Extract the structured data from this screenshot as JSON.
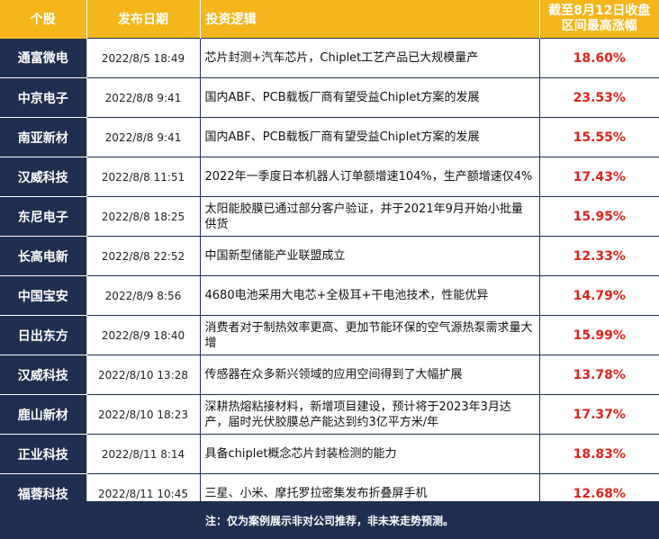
{
  "header": {
    "col_stock": "个股",
    "col_date": "发布日期",
    "col_logic": "投资逻辑",
    "col_gain_line1": "截至8月12日收盘",
    "col_gain_line2": "区间最高涨幅"
  },
  "rows": [
    {
      "name": "通富微电",
      "date": "2022/8/5 18:49",
      "logic": "芯片封测+汽车芯片，Chiplet工艺产品已大规模量产",
      "gain": "18.60%"
    },
    {
      "name": "中京电子",
      "date": "2022/8/8 9:41",
      "logic": "国内ABF、PCB载板厂商有望受益Chiplet方案的发展",
      "gain": "23.53%"
    },
    {
      "name": "南亚新材",
      "date": "2022/8/8 9:41",
      "logic": "国内ABF、PCB载板厂商有望受益Chiplet方案的发展",
      "gain": "15.55%"
    },
    {
      "name": "汉威科技",
      "date": "2022/8/8 11:51",
      "logic": "2022年一季度日本机器人订单额增速104%，生产额增速仅4%",
      "gain": "17.43%"
    },
    {
      "name": "东尼电子",
      "date": "2022/8/8 18:25",
      "logic": "太阳能胶膜已通过部分客户验证，并于2021年9月开始小批量供货",
      "gain": "15.95%"
    },
    {
      "name": "长高电新",
      "date": "2022/8/8 22:52",
      "logic": "中国新型储能产业联盟成立",
      "gain": "12.33%"
    },
    {
      "name": "中国宝安",
      "date": "2022/8/9 8:56",
      "logic": "4680电池采用大电芯+全极耳+干电池技术，性能优异",
      "gain": "14.79%"
    },
    {
      "name": "日出东方",
      "date": "2022/8/9 18:40",
      "logic": "消费者对于制热效率更高、更加节能环保的空气源热泵需求量大增",
      "gain": "15.99%"
    },
    {
      "name": "汉威科技",
      "date": "2022/8/10 13:28",
      "logic": "传感器在众多新兴领域的应用空间得到了大幅扩展",
      "gain": "13.78%"
    },
    {
      "name": "鹿山新材",
      "date": "2022/8/10 18:23",
      "logic": "深耕热熔粘接材料，新增项目建设，预计将于2023年3月达产，届时光伏胶膜总产能达到约3亿平方米/年",
      "gain": "17.37%"
    },
    {
      "name": "正业科技",
      "date": "2022/8/11 8:14",
      "logic": "具备chiplet概念芯片封装检测的能力",
      "gain": "18.83%"
    },
    {
      "name": "福蓉科技",
      "date": "2022/8/11 10:45",
      "logic": "三星、小米、摩托罗拉密集发布折叠屏手机",
      "gain": "12.68%"
    }
  ],
  "footer": {
    "note": "注：仅为案例展示非对公司推荐，非未来走势预测。"
  },
  "colors": {
    "header_bg": "#f4b61a",
    "name_bg": "#1f2f4f",
    "gain_text": "#e0231b"
  }
}
